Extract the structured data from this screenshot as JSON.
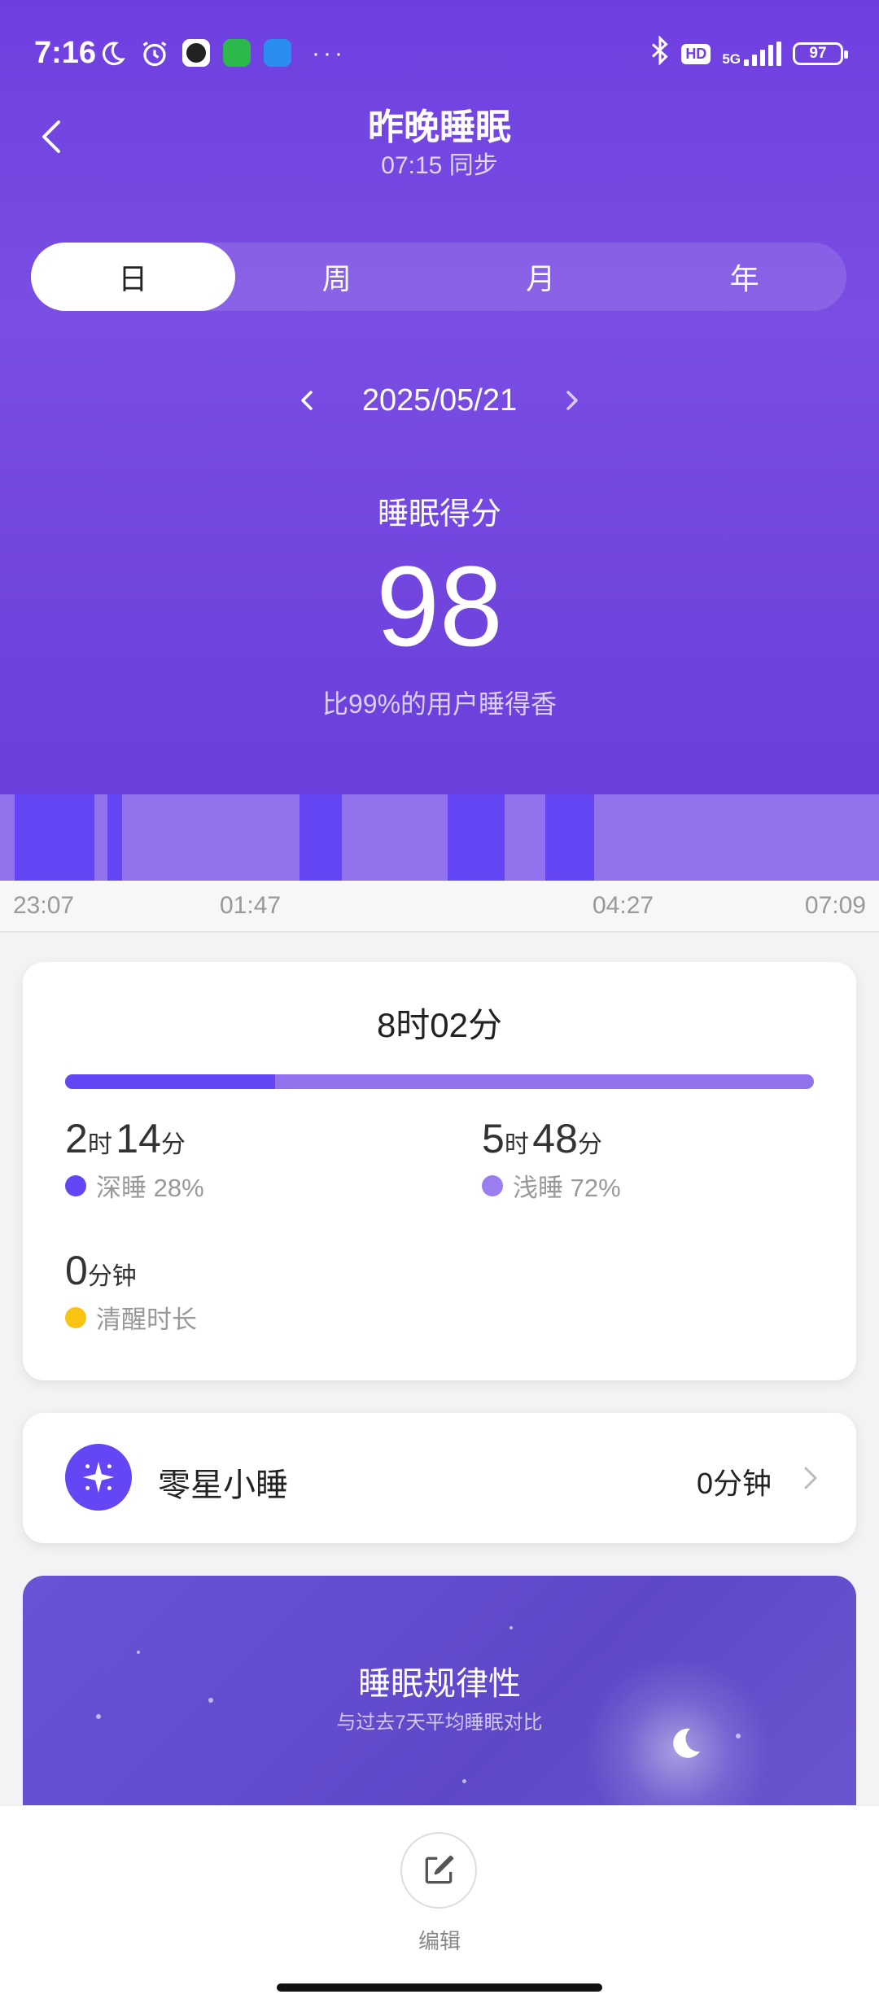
{
  "status_bar": {
    "time": "7:16",
    "network": "5G",
    "hd": "HD",
    "battery": "97"
  },
  "header": {
    "title": "昨晚睡眠",
    "sync_text": "07:15 同步"
  },
  "tabs": [
    {
      "label": "日",
      "active": true
    },
    {
      "label": "周",
      "active": false
    },
    {
      "label": "月",
      "active": false
    },
    {
      "label": "年",
      "active": false
    }
  ],
  "date": "2025/05/21",
  "score": {
    "label": "睡眠得分",
    "value": "98",
    "comparison": "比99%的用户睡得香"
  },
  "timeline": {
    "start_label": "23:07",
    "label_2": "01:47",
    "label_3": "04:27",
    "end_label": "07:09",
    "deep_color": "#6446f5",
    "light_color": "#9272ec"
  },
  "summary": {
    "total": "8时02分",
    "deep_fraction": 0.28,
    "deep": {
      "hours": "2",
      "h_unit": "时",
      "minutes": "14",
      "m_unit": "分",
      "label": "深睡 28%",
      "color": "#6446f5"
    },
    "light": {
      "hours": "5",
      "h_unit": "时",
      "minutes": "48",
      "m_unit": "分",
      "label": "浅睡 72%",
      "color": "#9a7ef0"
    },
    "awake": {
      "value": "0",
      "unit": "分钟",
      "label": "清醒时长",
      "color": "#f8c313"
    }
  },
  "nap": {
    "title": "零星小睡",
    "value": "0分钟"
  },
  "regularity": {
    "title": "睡眠规律性",
    "subtitle": "与过去7天平均睡眠对比"
  },
  "bottom": {
    "edit_label": "编辑"
  }
}
